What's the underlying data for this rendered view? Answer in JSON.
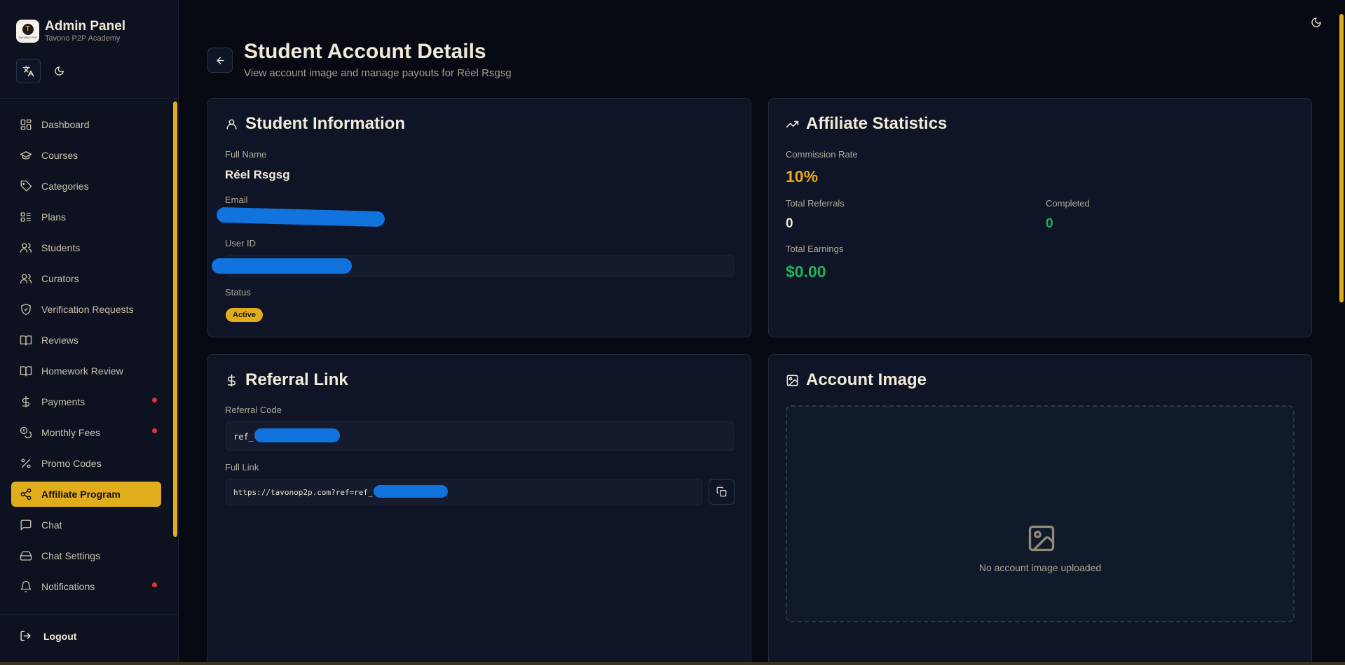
{
  "brand": {
    "title": "Admin Panel",
    "subtitle": "Tavono P2P Academy",
    "logo_letter": "T",
    "logo_caption": "TAVONO P2P"
  },
  "nav": {
    "items": [
      {
        "label": "Dashboard",
        "icon": "dashboard-icon"
      },
      {
        "label": "Courses",
        "icon": "graduation-cap-icon"
      },
      {
        "label": "Categories",
        "icon": "tag-icon"
      },
      {
        "label": "Plans",
        "icon": "list-icon"
      },
      {
        "label": "Students",
        "icon": "users-icon"
      },
      {
        "label": "Curators",
        "icon": "users-icon"
      },
      {
        "label": "Verification Requests",
        "icon": "shield-check-icon"
      },
      {
        "label": "Reviews",
        "icon": "book-open-icon"
      },
      {
        "label": "Homework Review",
        "icon": "book-open-icon"
      },
      {
        "label": "Payments",
        "icon": "dollar-icon",
        "dot": true
      },
      {
        "label": "Monthly Fees",
        "icon": "coins-icon",
        "dot": true
      },
      {
        "label": "Promo Codes",
        "icon": "percent-icon"
      },
      {
        "label": "Affiliate Program",
        "icon": "share-icon",
        "active": true
      },
      {
        "label": "Chat",
        "icon": "message-square-icon"
      },
      {
        "label": "Chat Settings",
        "icon": "settings-drive-icon"
      },
      {
        "label": "Notifications",
        "icon": "bell-icon",
        "dot": true
      }
    ],
    "logout_label": "Logout"
  },
  "header": {
    "title": "Student Account Details",
    "subtitle": "View account image and manage payouts for Réel Rsgsg"
  },
  "student_info": {
    "title": "Student Information",
    "full_name_label": "Full Name",
    "full_name": "Réel Rsgsg",
    "email_label": "Email",
    "user_id_label": "User ID",
    "status_label": "Status",
    "status": "Active"
  },
  "affiliate_stats": {
    "title": "Affiliate Statistics",
    "commission_label": "Commission Rate",
    "commission": "10%",
    "total_referrals_label": "Total Referrals",
    "total_referrals": "0",
    "completed_label": "Completed",
    "completed": "0",
    "total_earnings_label": "Total Earnings",
    "total_earnings": "$0.00"
  },
  "referral": {
    "title": "Referral Link",
    "code_label": "Referral Code",
    "code_prefix": "ref_",
    "link_label": "Full Link",
    "link_prefix": "https://tavonop2p.com?ref=ref_"
  },
  "account_image": {
    "title": "Account Image",
    "empty_text": "No account image uploaded"
  },
  "colors": {
    "accent": "#e0ad1c",
    "success": "#1fb457",
    "danger": "#e5333b",
    "background": "#070a12"
  }
}
